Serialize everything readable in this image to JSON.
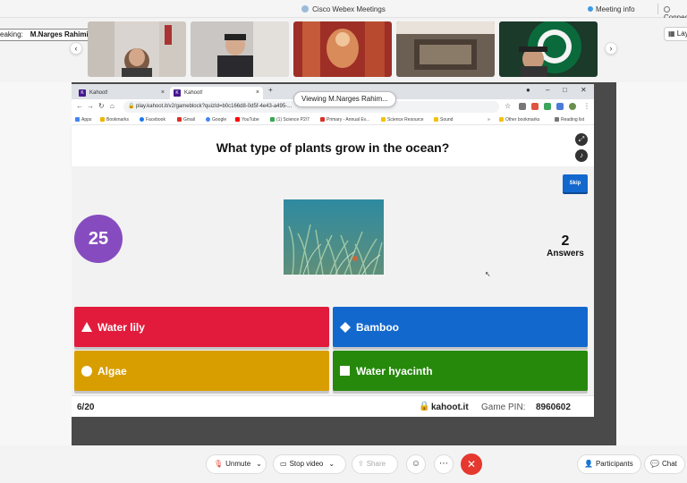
{
  "titlebar": {
    "title": "Cisco Webex Meetings",
    "meeting_info": "Meeting info",
    "connect": "Connec"
  },
  "strip": {
    "speaking_prefix": "eaking:",
    "speaking_name": "M.Narges Rahimiparvar (C...",
    "layout": "Lay"
  },
  "share": {
    "viewing": "Viewing M.Narges Rahim..."
  },
  "browser": {
    "tab1": "Kahoot!",
    "tab2": "Kahoot!",
    "url": "play.kahoot.it/v2/gameblock?quizId=b0c166d8-0d5f-4e43-a495-...",
    "bookmarks": [
      "Apps",
      "Bookmarks",
      "Facebook",
      "Gmail",
      "Google",
      "YouTube",
      "(1) Science P2/7",
      "Primary - Annual Ev...",
      "Science Resource",
      "Sound",
      "Other bookmarks",
      "Reading list"
    ]
  },
  "kahoot": {
    "question": "What type of plants grow in the ocean?",
    "skip": "Skip",
    "timer": "25",
    "answers_count": "2",
    "answers_label": "Answers",
    "answers": [
      {
        "label": "Water lily",
        "color": "#e21b3c",
        "shape": "triangle"
      },
      {
        "label": "Bamboo",
        "color": "#1368ce",
        "shape": "diamond"
      },
      {
        "label": "Algae",
        "color": "#d89e00",
        "shape": "circle"
      },
      {
        "label": "Water hyacinth",
        "color": "#26890c",
        "shape": "square"
      }
    ],
    "question_number": "6/20",
    "site": "kahoot.it",
    "pin_label": "Game PIN:",
    "pin": "8960602"
  },
  "toolbar": {
    "unmute": "Unmute",
    "stop_video": "Stop video",
    "share": "Share",
    "participants": "Participants",
    "chat": "Chat"
  }
}
